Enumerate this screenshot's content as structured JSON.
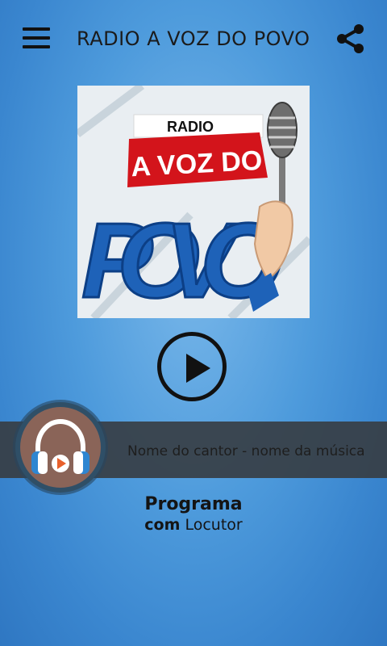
{
  "header": {
    "menu_icon": "hamburger-menu-icon",
    "title": "RADIO A VOZ DO POVO",
    "share_icon": "share-icon"
  },
  "logo": {
    "line1": "RADIO",
    "line2": "A VOZ DO",
    "line3": "POVO",
    "colors": {
      "red": "#d3141b",
      "blue": "#1e62b8"
    }
  },
  "player": {
    "play_icon": "play-icon",
    "now_playing": "Nome do cantor - nome da música"
  },
  "program": {
    "title": "Programa",
    "prefix": "com",
    "host": "Locutor"
  },
  "colors": {
    "background": "#4e9bdc",
    "bar": "#373e44",
    "avatar": "#8a6458",
    "headphones": "#ffffff",
    "accent": "#e8602c"
  }
}
